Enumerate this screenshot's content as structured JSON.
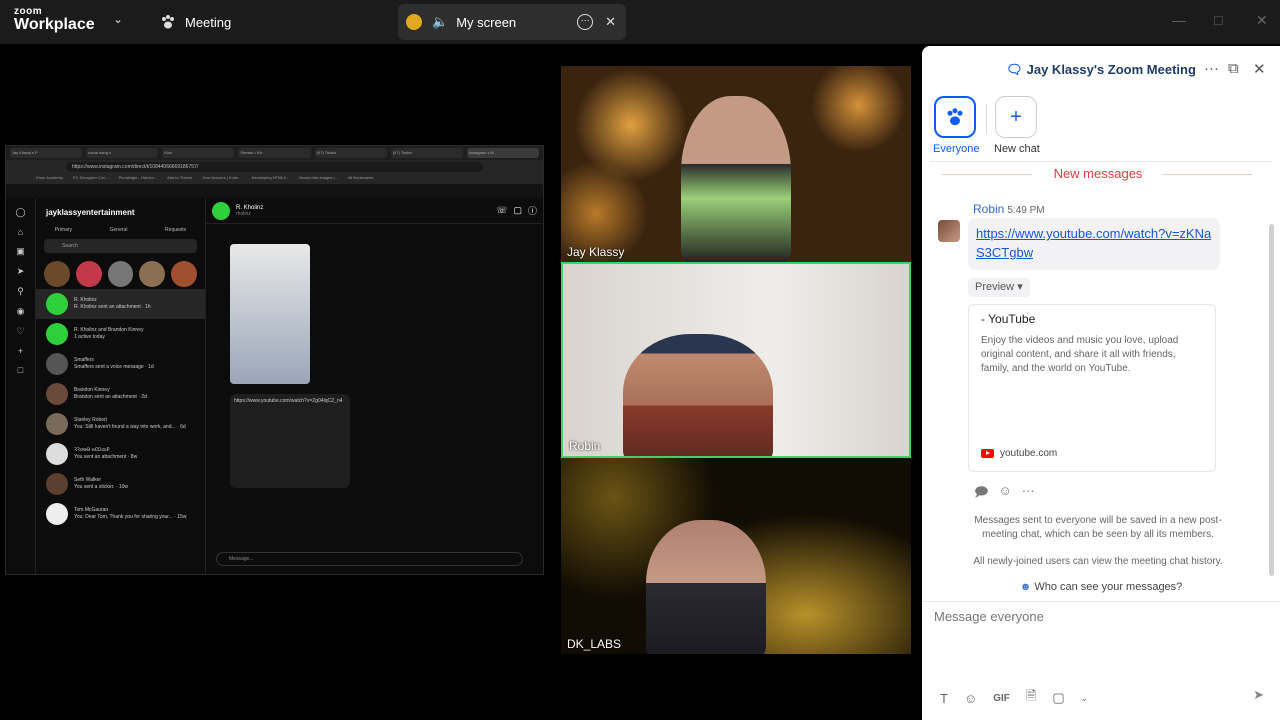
{
  "app": {
    "logo_top": "zoom",
    "logo_bottom": "Workplace"
  },
  "tabs": {
    "meeting_label": "Meeting",
    "screen_label": "My screen"
  },
  "shared_screen": {
    "browser_tabs": [
      "Jay Klassy's P",
      "come hang o",
      "Kick",
      "Stream • Kic",
      "(97) Twitch",
      "(97) Twitch",
      "Instagram • M"
    ],
    "url": "https://www.instagram.com/direct/t/10844066669186757/",
    "bookmarks": [
      "Khan Academy",
      "PC Decrypter Con...",
      "Pluralsight - Hardco...",
      "Add to Theme",
      "Your Account | Kube...",
      "Developing HTML5...",
      "Mount disk images i...",
      "All Bookmarks"
    ],
    "ig_username": "jayklassyentertainment",
    "ig_filters": [
      "Primary",
      "General",
      "Requests"
    ],
    "ig_search": "Search",
    "conversations": [
      {
        "name": "R. Kholinz",
        "preview": "R. Kholinz sent an attachment · 1h"
      },
      {
        "name": "R. Kholinz and Brandon Kinney",
        "preview": "1 active today"
      },
      {
        "name": "Smaffers",
        "preview": "Smaffers sent a voice message · 1d"
      },
      {
        "name": "Brandon Kinney",
        "preview": "Brandon sent an attachment · 2d"
      },
      {
        "name": "Stanley Robert",
        "preview": "You: Still haven't found a way into work, and... · 6d"
      },
      {
        "name": "ꝚꝚꝍꝋꝊ ꝋꝎꝏꝐ",
        "preview": "You sent an attachment · 8w"
      },
      {
        "name": "Seth Walker",
        "preview": "You sent a sticker. · 10w"
      },
      {
        "name": "Tom McGauran",
        "preview": "You: Dear Tom, Thank you for sharing your... · 15w"
      }
    ],
    "chat_name": "R. Kholinz",
    "chat_handle": "rholinz",
    "chat_link": "https://www.youtube.com/watch?v=Zg04lqCZ_n4",
    "message_placeholder": "Message..."
  },
  "participants": [
    {
      "name": "Jay Klassy"
    },
    {
      "name": "Robin"
    },
    {
      "name": "DK_LABS"
    }
  ],
  "chat_panel": {
    "title": "Jay Klassy's Zoom Meeting",
    "chats": [
      {
        "label": "Everyone",
        "active": true
      },
      {
        "label": "New chat",
        "active": false
      }
    ],
    "new_messages_label": "New messages",
    "message": {
      "sender": "Robin",
      "time": "5:49 PM",
      "link": "https://www.youtube.com/watch?v=zKNaS3CTgbw"
    },
    "preview_label": "Preview",
    "preview_card": {
      "title": "- YouTube",
      "description": "Enjoy the videos and music you love, upload original content, and share it all with friends, family, and the world on YouTube.",
      "site": "youtube.com"
    },
    "notice_1": "Messages sent to everyone will be saved in a new post-meeting chat, which can be seen by all its members.",
    "notice_2": "All newly-joined users can view the meeting chat history.",
    "who_can_see": "Who can see your messages?",
    "input_placeholder": "Message everyone",
    "accent_color": "#0b5cff"
  }
}
